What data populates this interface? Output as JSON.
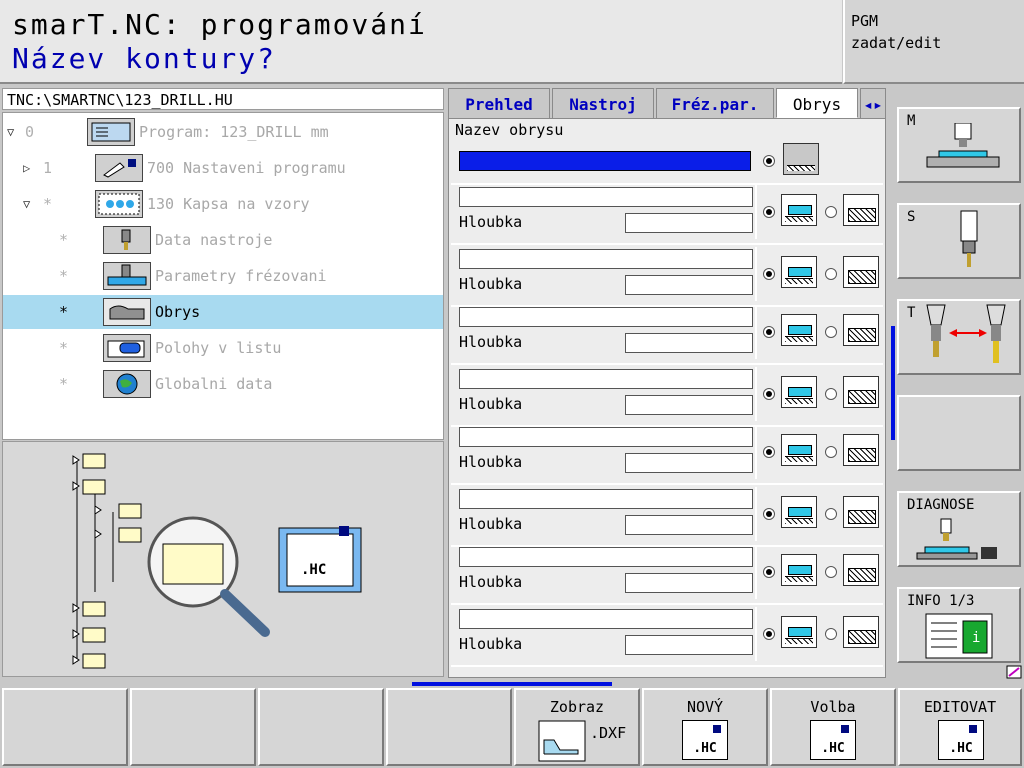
{
  "header": {
    "title": "smarT.NC: programování",
    "subtitle": "Název kontury?",
    "mode_line1": "PGM",
    "mode_line2": "zadat/edit"
  },
  "path": "TNC:\\SMARTNC\\123_DRILL.HU",
  "tree": {
    "rows": [
      {
        "num": "0",
        "label": "Program: 123_DRILL mm",
        "icon": "program-icon"
      },
      {
        "num": "1",
        "label": "700 Nastaveni programu",
        "icon": "settings-icon"
      },
      {
        "num": "*",
        "label": "130 Kapsa na vzory",
        "icon": "pattern-pocket-icon"
      },
      {
        "num": "*",
        "label": "Data nastroje",
        "icon": "tool-data-icon"
      },
      {
        "num": "*",
        "label": "Parametry frézovani",
        "icon": "milling-params-icon"
      },
      {
        "num": "*",
        "label": "Obrys",
        "icon": "contour-icon"
      },
      {
        "num": "*",
        "label": "Polohy v listu",
        "icon": "positions-icon"
      },
      {
        "num": "*",
        "label": "Globalni data",
        "icon": "global-data-icon"
      }
    ]
  },
  "preview": {
    "file_label": ".HC"
  },
  "tabs": [
    {
      "label": "Prehled"
    },
    {
      "label": "Nastroj"
    },
    {
      "label": "Fréz.par."
    },
    {
      "label": "Obrys"
    }
  ],
  "tab_scroll": "◂▸",
  "form": {
    "contour_label": "Nazev obrysu",
    "depth_label": "Hloubka",
    "row_count": 9
  },
  "side_buttons": [
    {
      "label": "M"
    },
    {
      "label": "S"
    },
    {
      "label": "T"
    },
    {
      "label": ""
    },
    {
      "label": "DIAGNOSE"
    },
    {
      "label": "INFO 1/3"
    }
  ],
  "info_icon_letter": "i",
  "softkeys": [
    {
      "label": ""
    },
    {
      "label": ""
    },
    {
      "label": ""
    },
    {
      "label": ""
    },
    {
      "label": "Zobraz",
      "sub": ".DXF"
    },
    {
      "label": "NOVÝ",
      "sub": ".HC"
    },
    {
      "label": "Volba",
      "sub": ".HC"
    },
    {
      "label": "EDITOVAT",
      "sub": ".HC"
    }
  ],
  "colors": {
    "accent_blue": "#0000b0",
    "field_active": "#0a1ee8",
    "selection": "#a8daf0",
    "pocket_fill": "#30c8e8"
  }
}
